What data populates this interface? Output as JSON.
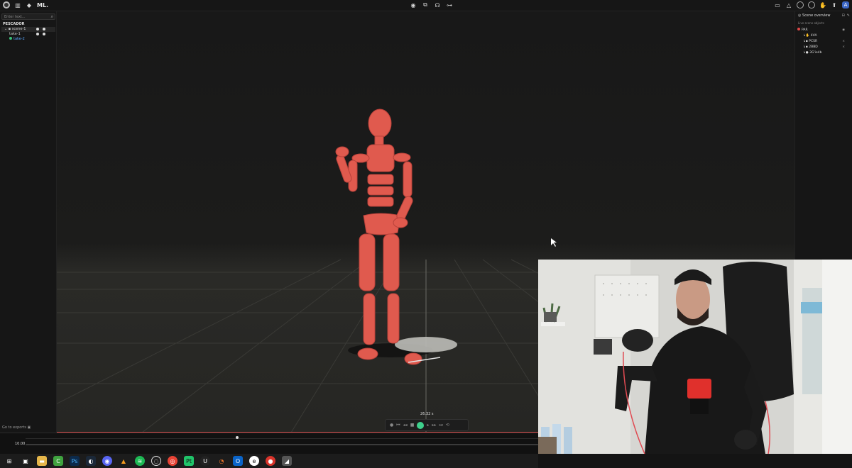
{
  "app": {
    "title": "ML."
  },
  "left_panel": {
    "search_placeholder": "Enter text...",
    "group_name": "PESCADOR",
    "scene_name": "scene-1",
    "takes": [
      "take-1",
      "take-2"
    ],
    "goto_label": "Go to exports"
  },
  "right_panel": {
    "title": "Scene overview",
    "subtitle": "Live scene objects",
    "root": "PAR",
    "items": [
      "4VA",
      "PCSR",
      "2BBD",
      "3G'ie4b"
    ]
  },
  "viewport": {
    "timecode": "26.32 s"
  },
  "timeline": {
    "zoom_value": "10.00",
    "playhead_fraction": 0.41
  },
  "colors": {
    "accent_green": "#3ed08c",
    "avatar_red": "#e05a4e",
    "marker_red": "#e04848",
    "link_blue": "#5aa8ff"
  },
  "icons": {
    "taskbar": [
      "windows-icon",
      "task-view-icon",
      "file-explorer-icon",
      "app-green-icon",
      "photoshop-icon",
      "steam-icon",
      "discord-icon",
      "vlc-icon",
      "spotify-icon",
      "obs-icon",
      "chrome-icon",
      "pycharm-icon",
      "unreal-icon",
      "blender-icon",
      "outlook-icon",
      "app-e-icon",
      "app-red-icon",
      "app-dark-icon"
    ]
  }
}
